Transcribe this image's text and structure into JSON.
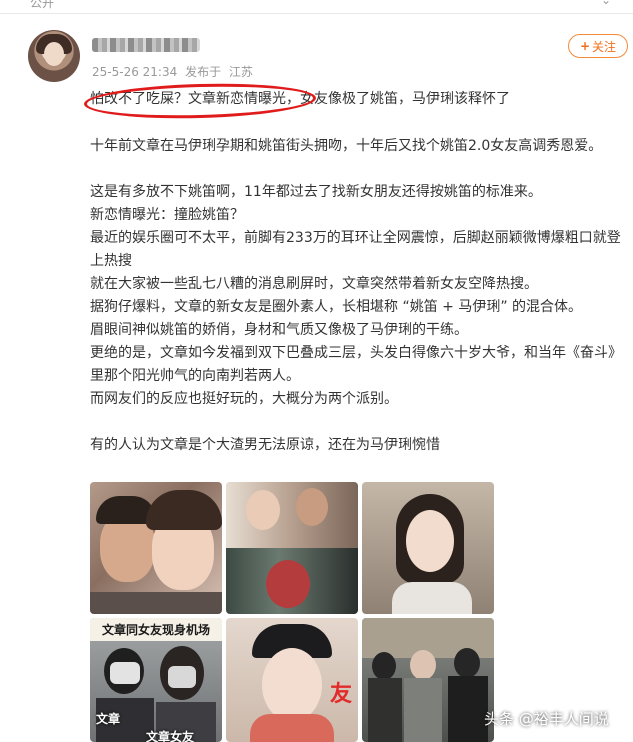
{
  "topbar": {
    "label": "公开",
    "chevron": "⌄"
  },
  "author": {
    "post_time": "25-5-26 21:34",
    "published_from": "发布于",
    "location": "江苏"
  },
  "follow_button": {
    "plus": "+",
    "label": "关注"
  },
  "article": {
    "headline": "怕改不了吃屎？文章新恋情曝光，女友像极了姚笛，马伊琍该释怀了",
    "paragraphs": [
      "十年前文章在马伊琍孕期和姚笛街头拥吻，十年后又找个姚笛2.0女友高调秀恩爱。",
      "这是有多放不下姚笛啊，11年都过去了找新女朋友还得按姚笛的标准来。",
      "新恋情曝光：撞脸姚笛？",
      "最近的娱乐圈可不太平，前脚有233万的耳环让全网震惊，后脚赵丽颖微博爆粗口就登上热搜",
      "就在大家被一些乱七八糟的消息刷屏时，文章突然带着新女友空降热搜。",
      "据狗仔爆料，文章的新女友是圈外素人，长相堪称 “姚笛 + 马伊琍” 的混合体。",
      "眉眼间神似姚笛的娇俏，身材和气质又像极了马伊琍的干练。",
      "更绝的是，文章如今发福到双下巴叠成三层，头发白得像六十岁大爷，和当年《奋斗》里那个阳光帅气的向南判若两人。",
      "而网友们的反应也挺好玩的，大概分为两个派别。",
      "有的人认为文章是个大渣男无法原谅，还在为马伊琍惋惜"
    ]
  },
  "images": {
    "image5_caption": "文章同女友现身机场",
    "image5_tag_left": "文章",
    "image5_tag_right": "文章女友",
    "image6_overlay": "友"
  },
  "watermark": "头条 @裕丰人间说"
}
